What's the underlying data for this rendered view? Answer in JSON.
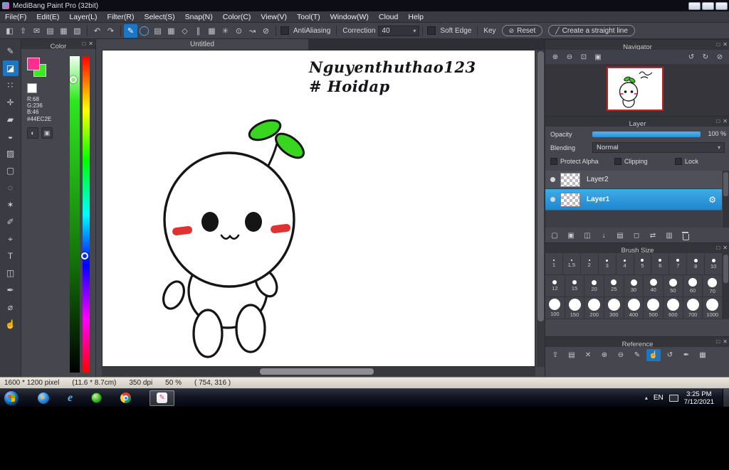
{
  "titlebar": {
    "title": "MediBang Paint Pro (32bit)"
  },
  "menu": {
    "items": [
      "File(F)",
      "Edit(E)",
      "Layer(L)",
      "Filter(R)",
      "Select(S)",
      "Snap(N)",
      "Color(C)",
      "View(V)",
      "Tool(T)",
      "Window(W)",
      "Cloud",
      "Help"
    ]
  },
  "icons": {
    "popout": "□",
    "close": "✕",
    "dropdown_arrow": "▾",
    "gear": "⚙",
    "tray_arrow": "▴",
    "reset": "⊘",
    "line": "╱"
  },
  "colors": {
    "accent_blue": "#1d76c4",
    "selected_layer": "#2b8fd8",
    "navigator_border": "#c22323",
    "blush_red": "#e23131",
    "leaf_green": "#38d61f"
  },
  "toolbar": {
    "file_icons": [
      {
        "name": "palette-icon",
        "glyph": "◧"
      },
      {
        "name": "upload-icon",
        "glyph": "⇧"
      },
      {
        "name": "comment-icon",
        "glyph": "✉"
      },
      {
        "name": "document-icon",
        "glyph": "▤"
      },
      {
        "name": "canvas-grid-icon",
        "glyph": "▦"
      },
      {
        "name": "material-panel-icon",
        "glyph": "▧"
      }
    ],
    "history_icons": [
      {
        "name": "undo-icon",
        "glyph": "↶"
      },
      {
        "name": "redo-icon",
        "glyph": "↷"
      }
    ],
    "brush_icons": [
      {
        "name": "pen-tool-icon",
        "glyph": "✎",
        "active": true
      },
      {
        "name": "brush-size-circle-icon",
        "glyph": "◯",
        "cls": "accent"
      }
    ],
    "grid_icons": [
      {
        "name": "grid-lines-icon",
        "glyph": "▤"
      },
      {
        "name": "grid-squares-icon",
        "glyph": "▦"
      },
      {
        "name": "perspective-grid-icon",
        "glyph": "◇"
      }
    ],
    "snap_icons": [
      {
        "name": "snap-parallel-icon",
        "glyph": "∥"
      },
      {
        "name": "snap-grid-icon",
        "glyph": "▦"
      },
      {
        "name": "snap-radial-icon",
        "glyph": "✳"
      },
      {
        "name": "snap-circle-icon",
        "glyph": "⊙"
      },
      {
        "name": "snap-curve-icon",
        "glyph": "↝"
      },
      {
        "name": "snap-off-icon",
        "glyph": "⊘"
      }
    ],
    "antialiasing_label": "AntiAliasing",
    "correction_label": "Correction",
    "correction_value": "40",
    "soft_edge_label": "Soft Edge",
    "key_label": "Key",
    "reset_label": "Reset",
    "straight_line_label": "Create a straight line"
  },
  "tools": {
    "items": [
      {
        "name": "brush-tool",
        "glyph": "✎"
      },
      {
        "name": "eraser-tool",
        "glyph": "◪",
        "active": true
      },
      {
        "name": "dot-tool",
        "glyph": "∷"
      },
      {
        "name": "move-tool",
        "glyph": "✛"
      },
      {
        "name": "fill-tool",
        "glyph": "▰"
      },
      {
        "name": "bucket-tool",
        "glyph": "◒"
      },
      {
        "name": "gradient-tool",
        "glyph": "▨"
      },
      {
        "name": "select-tool",
        "glyph": "▢"
      },
      {
        "name": "lasso-tool",
        "glyph": "◌"
      },
      {
        "name": "magic-wand-tool",
        "glyph": "✶"
      },
      {
        "name": "select-pen-tool",
        "glyph": "✐"
      },
      {
        "name": "operation-tool",
        "glyph": "⌖"
      },
      {
        "name": "text-tool",
        "glyph": "T"
      },
      {
        "name": "divide-tool",
        "glyph": "◫"
      },
      {
        "name": "eyedropper-tool",
        "glyph": "✒"
      },
      {
        "name": "measure-tool",
        "glyph": "⌀"
      },
      {
        "name": "hand-tool",
        "glyph": "☝"
      }
    ]
  },
  "color_panel": {
    "title": "Color",
    "rgb": [
      "R:68",
      "G:236",
      "B:46"
    ],
    "hex": "#44EC2E",
    "foreground_color": "#FF2E8C",
    "selected_color": "#3CE81E"
  },
  "canvas": {
    "tab": "Untitled",
    "signature_line1": "Nguyenthuthao123",
    "signature_line2": "# Hoidap"
  },
  "navigator": {
    "title": "Navigator",
    "zoom_icons": [
      {
        "name": "zoom-in-icon",
        "glyph": "⊕"
      },
      {
        "name": "zoom-out-icon",
        "glyph": "⊖"
      },
      {
        "name": "zoom-reset-icon",
        "glyph": "⊡"
      },
      {
        "name": "zoom-fit-icon",
        "glyph": "▣"
      }
    ],
    "view_icons": [
      {
        "name": "rotate-left-icon",
        "glyph": "↺"
      },
      {
        "name": "rotate-right-icon",
        "glyph": "↻"
      },
      {
        "name": "reset-rotation-icon",
        "glyph": "⊘"
      }
    ]
  },
  "layer": {
    "title": "Layer",
    "opacity_label": "Opacity",
    "opacity_value": "100 %",
    "blending_label": "Blending",
    "blending_value": "Normal",
    "protect_alpha_label": "Protect Alpha",
    "clipping_label": "Clipping",
    "lock_label": "Lock",
    "layers": [
      {
        "name": "Layer2"
      },
      {
        "name": "Layer1"
      }
    ],
    "selected_layer": "Layer1",
    "action_icons": [
      {
        "name": "add-layer-icon",
        "glyph": "▢"
      },
      {
        "name": "add-pixel-layer-icon",
        "glyph": "▣"
      },
      {
        "name": "duplicate-layer-icon",
        "glyph": "◫"
      },
      {
        "name": "merge-down-icon",
        "glyph": "↓"
      },
      {
        "name": "layer-folder-icon",
        "glyph": "▤"
      },
      {
        "name": "clear-layer-icon",
        "glyph": "◻"
      },
      {
        "name": "transfer-layer-icon",
        "glyph": "⇄"
      },
      {
        "name": "mask-layer-icon",
        "glyph": "▥"
      },
      {
        "name": "delete-layer-icon",
        "trash": true
      }
    ]
  },
  "brush_size": {
    "title": "Brush Size",
    "rows": [
      [
        "1",
        "1.5",
        "2",
        "3",
        "4",
        "5",
        "6",
        "7",
        "8",
        "10"
      ],
      [
        "12",
        "15",
        "20",
        "25",
        "30",
        "40",
        "50",
        "60",
        "70"
      ],
      [
        "100",
        "150",
        "200",
        "300",
        "400",
        "500",
        "600",
        "700",
        "1000"
      ]
    ]
  },
  "reference": {
    "title": "Reference",
    "icons": [
      {
        "name": "ref-up-icon",
        "glyph": "⇧"
      },
      {
        "name": "ref-folder-icon",
        "glyph": "▤"
      },
      {
        "name": "ref-close-icon",
        "glyph": "✕"
      },
      {
        "name": "ref-zoom-in-icon",
        "glyph": "⊕"
      },
      {
        "name": "ref-zoom-out-icon",
        "glyph": "⊖"
      },
      {
        "name": "ref-pen-icon",
        "glyph": "✎"
      },
      {
        "name": "ref-hand-icon",
        "glyph": "☝",
        "active": true
      },
      {
        "name": "ref-rotate-icon",
        "glyph": "↺"
      },
      {
        "name": "ref-eyedropper-icon",
        "glyph": "✒"
      },
      {
        "name": "ref-grid-icon",
        "glyph": "▦"
      }
    ]
  },
  "statusbar": {
    "segments": [
      "1600 * 1200 pixel",
      "(11.6 * 8.7cm)",
      "350 dpi",
      "50 %",
      "( 754, 316 )"
    ]
  },
  "taskbar": {
    "ie_glyph": "e",
    "language": "EN",
    "time": "3:25 PM",
    "date": "7/12/2021"
  }
}
